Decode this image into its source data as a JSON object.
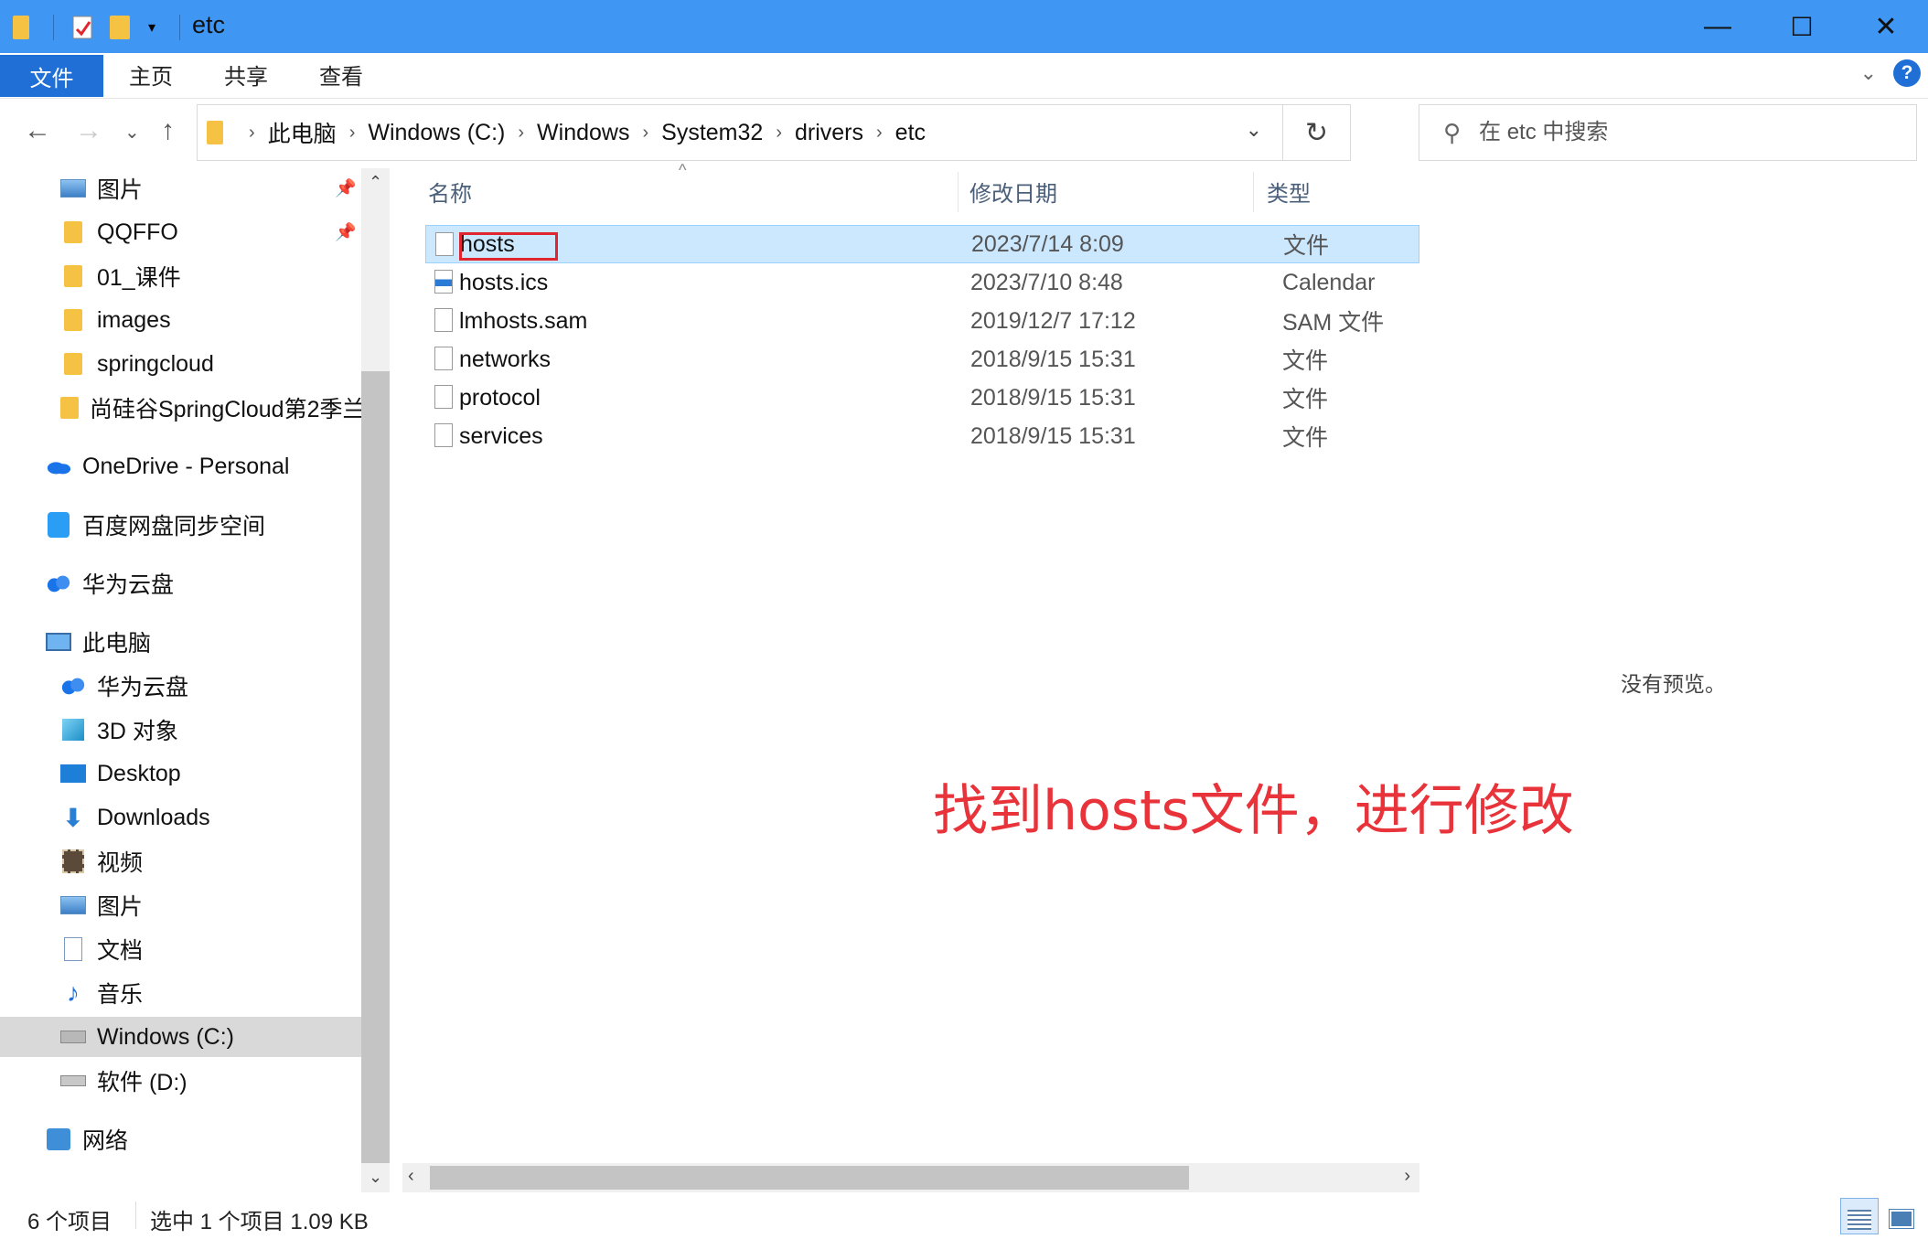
{
  "window": {
    "title": "etc",
    "minimize_glyph": "—",
    "maximize_glyph": "☐",
    "close_glyph": "✕"
  },
  "ribbon": {
    "tabs": [
      "文件",
      "主页",
      "共享",
      "查看"
    ],
    "help_glyph": "?"
  },
  "address": {
    "crumbs": [
      "此电脑",
      "Windows (C:)",
      "Windows",
      "System32",
      "drivers",
      "etc"
    ]
  },
  "search": {
    "placeholder": "在 etc 中搜索"
  },
  "sidebar": {
    "quick_access": [
      {
        "label": "图片",
        "icon": "pictures-icon",
        "pinned": true
      },
      {
        "label": "QQFFO",
        "icon": "folder-icon",
        "pinned": true
      },
      {
        "label": "01_课件",
        "icon": "folder-icon",
        "pinned": false
      },
      {
        "label": "images",
        "icon": "folder-icon",
        "pinned": false
      },
      {
        "label": "springcloud",
        "icon": "folder-icon",
        "pinned": false
      },
      {
        "label": "尚硅谷SpringCloud第2季兰",
        "icon": "folder-icon",
        "pinned": false
      }
    ],
    "onedrive": "OneDrive - Personal",
    "baidu": "百度网盘同步空间",
    "huawei_top": "华为云盘",
    "this_pc": "此电脑",
    "pc_items": [
      {
        "label": "华为云盘",
        "icon": "cloud-icon"
      },
      {
        "label": "3D 对象",
        "icon": "3d-objects-icon"
      },
      {
        "label": "Desktop",
        "icon": "desktop-icon"
      },
      {
        "label": "Downloads",
        "icon": "downloads-icon"
      },
      {
        "label": "视频",
        "icon": "videos-icon"
      },
      {
        "label": "图片",
        "icon": "pictures-icon"
      },
      {
        "label": "文档",
        "icon": "documents-icon"
      },
      {
        "label": "音乐",
        "icon": "music-icon"
      },
      {
        "label": "Windows (C:)",
        "icon": "drive-c-icon"
      },
      {
        "label": "软件 (D:)",
        "icon": "drive-d-icon"
      }
    ],
    "network": "网络"
  },
  "columns": {
    "name": "名称",
    "date": "修改日期",
    "type": "类型"
  },
  "files": [
    {
      "name": "hosts",
      "date": "2023/7/14 8:09",
      "type": "文件",
      "selected": true
    },
    {
      "name": "hosts.ics",
      "date": "2023/7/10 8:48",
      "type": "Calendar",
      "selected": false
    },
    {
      "name": "lmhosts.sam",
      "date": "2019/12/7 17:12",
      "type": "SAM 文件",
      "selected": false
    },
    {
      "name": "networks",
      "date": "2018/9/15 15:31",
      "type": "文件",
      "selected": false
    },
    {
      "name": "protocol",
      "date": "2018/9/15 15:31",
      "type": "文件",
      "selected": false
    },
    {
      "name": "services",
      "date": "2018/9/15 15:31",
      "type": "文件",
      "selected": false
    }
  ],
  "annotation": "找到hosts文件，进行修改",
  "preview": {
    "message": "没有预览。"
  },
  "status": {
    "count": "6 个项目",
    "selection": "选中 1 个项目  1.09 KB"
  },
  "colors": {
    "titlebar": "#3f96f3",
    "accent": "#1f6fd6",
    "selection": "#cce8ff",
    "annotation": "#e8333a"
  }
}
